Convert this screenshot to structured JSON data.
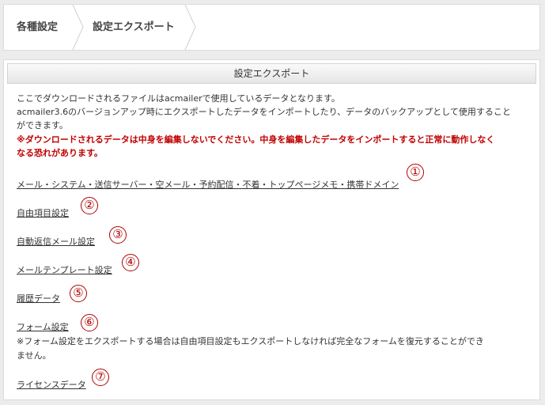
{
  "breadcrumb": {
    "items": [
      "各種設定",
      "設定エクスポート"
    ]
  },
  "panel": {
    "title": "設定エクスポート",
    "intro_line1": "ここでダウンロードされるファイルはacmailerで使用しているデータとなります。",
    "intro_line2": "acmailer3.6のバージョンアップ時にエクスポートしたデータをインポートしたり、データのバックアップとして使用すること",
    "intro_line3": "ができます。",
    "warning_line1": "※ダウンロードされるデータは中身を編集しないでください。中身を編集したデータをインポートすると正常に動作しなく",
    "warning_line2": "なる恐れがあります。",
    "links": [
      {
        "label": "メール・システム・送信サーバー・空メール・予約配信・不着・トップページメモ・携帯ドメイン",
        "badge": "①"
      },
      {
        "label": "自由項目設定",
        "badge": "②"
      },
      {
        "label": "自動返信メール設定",
        "badge": "③"
      },
      {
        "label": "メールテンプレート設定",
        "badge": "④"
      },
      {
        "label": "履歴データ",
        "badge": "⑤"
      },
      {
        "label": "フォーム設定",
        "badge": "⑥"
      },
      {
        "label": "ライセンスデータ",
        "badge": "⑦"
      }
    ],
    "form_note_line1": "※フォーム設定をエクスポートする場合は自由項目設定もエクスポートしなければ完全なフォームを復元することができ",
    "form_note_line2": "ません。"
  },
  "colors": {
    "warning": "#c00000",
    "badge": "#b00000"
  }
}
